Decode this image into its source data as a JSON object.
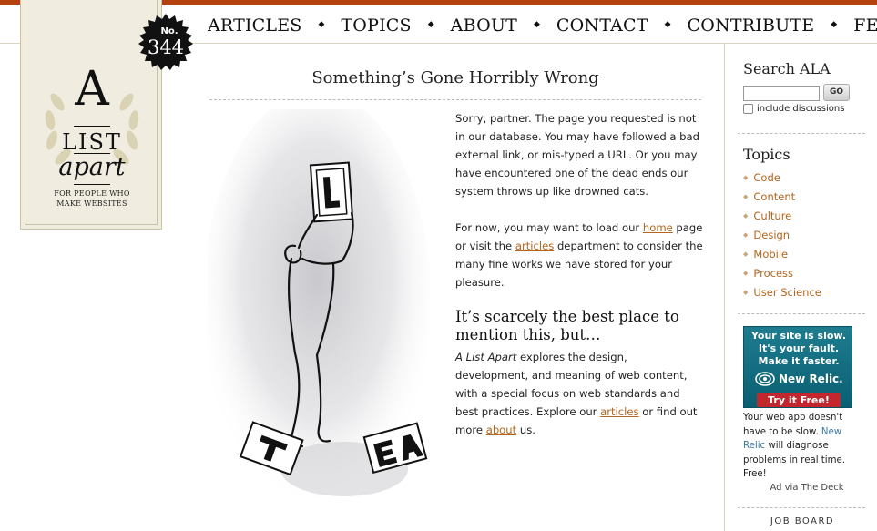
{
  "nav": {
    "items": [
      "ARTICLES",
      "TOPICS",
      "ABOUT",
      "CONTACT",
      "CONTRIBUTE",
      "FEED"
    ],
    "separator": "◆"
  },
  "logo": {
    "letter": "A",
    "word1": "LIST",
    "word2": "apart",
    "tagline_line1": "FOR PEOPLE WHO",
    "tagline_line2": "MAKE WEBSITES"
  },
  "issue": {
    "prefix": "No.",
    "number": "344"
  },
  "main": {
    "title": "Something’s Gone Horribly Wrong",
    "p1": "Sorry, partner. The page you requested is not in our database. You may have followed a bad external link, or mis-typed a URL. Or you may have encountered one of the dead ends our system throws up like drowned cats.",
    "p2_pre": "For now, you may want to load our ",
    "p2_link1": "home",
    "p2_mid": " page or visit the ",
    "p2_link2": "articles",
    "p2_post": " department to consider the many fine works we have stored for your pleasure.",
    "subheading": "It’s scarcely the best place to mention this, but…",
    "p3_em": "A List Apart",
    "p3_mid": " explores the design, development, and meaning of web content, with a special focus on web standards and best practices. Explore our ",
    "p3_link1": "articles",
    "p3_mid2": " or find out more ",
    "p3_link2": "about",
    "p3_post": " us."
  },
  "sidebar": {
    "search_title": "Search ALA",
    "search_value": "",
    "go_label": "GO",
    "include_label": "include discussions",
    "topics_title": "Topics",
    "topics": [
      "Code",
      "Content",
      "Culture",
      "Design",
      "Mobile",
      "Process",
      "User Science"
    ],
    "ad": {
      "line1": "Your site is slow.",
      "line2": "It's your fault.",
      "line3": "Make it faster.",
      "brand": "New Relic.",
      "button": "Try it Free!"
    },
    "ad_copy_pre": "Your web app doesn't have to be slow. ",
    "ad_copy_link": "New Relic",
    "ad_copy_post": " will diagnose problems in real time. Free!",
    "ad_via": "Ad via The Deck",
    "job_board": "JOB BOARD"
  },
  "colors": {
    "accent": "#b3420f",
    "link": "#b5651d",
    "logo_bg": "#f0ede0"
  }
}
